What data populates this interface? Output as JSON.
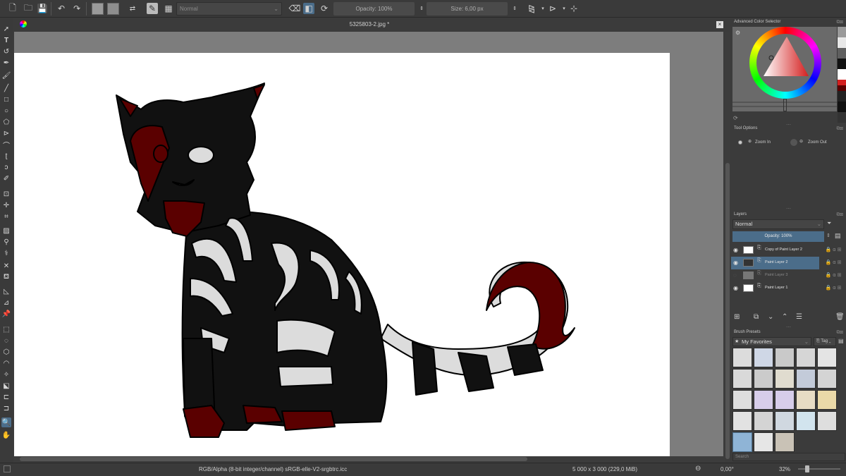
{
  "toolbar": {
    "blend_mode": "Normal",
    "opacity": "Opacity: 100%",
    "size": "Size: 6,00 px",
    "fg_color": "#9a9a9a",
    "bg_color": "#8e8e8e"
  },
  "document": {
    "tab_title": "5325803-2.jpg *"
  },
  "docker": {
    "color_selector_title": "Advanced Color Selector",
    "tool_options_title": "Tool Options",
    "zoom_in_label": "Zoom In",
    "zoom_out_label": "Zoom Out",
    "layers_title": "Layers",
    "layers_blend": "Normal",
    "layers_opacity": "Opacity:  100%",
    "layers": [
      {
        "name": "Copy of Paint Layer 2",
        "visible": true,
        "selected": false
      },
      {
        "name": "Paint Layer 2",
        "visible": true,
        "selected": true
      },
      {
        "name": "Paint Layer 3",
        "visible": false,
        "selected": false
      },
      {
        "name": "Paint Layer 1",
        "visible": true,
        "selected": false
      }
    ],
    "brush_presets_title": "Brush Presets",
    "brush_tag": "My Favorites",
    "tag_label": "Tag",
    "search_placeholder": "Search"
  },
  "status": {
    "color_space": "RGB/Alpha (8-bit integer/channel)  sRGB-elle-V2-srgbtrc.icc",
    "dimensions": "5 000 x 3 000 (229,0 MiB)",
    "rotation": "0,00°",
    "zoom": "32%"
  },
  "colors": {
    "accent": "#4b6d8a",
    "cat_black": "#111111",
    "cat_red": "#5a0000",
    "stripe": "#dcdcdc"
  }
}
